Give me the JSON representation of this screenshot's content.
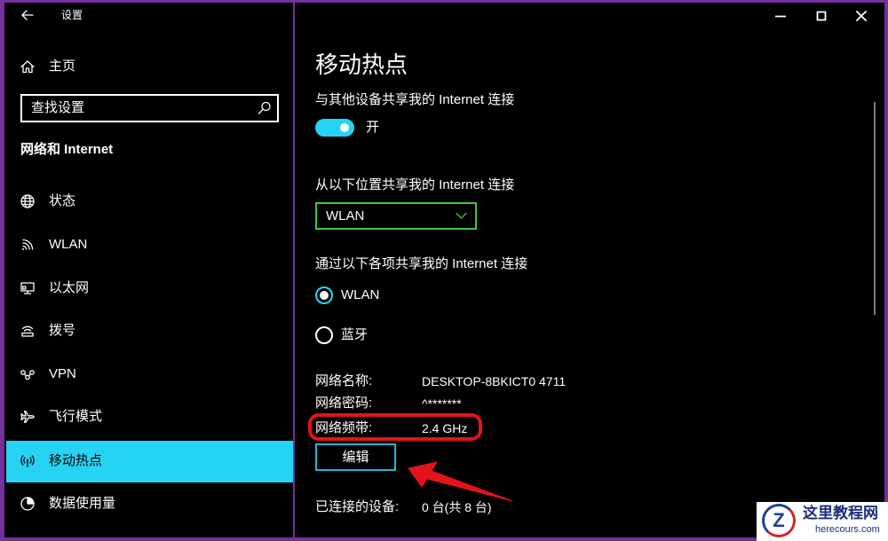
{
  "window": {
    "title": "设置",
    "icons": {
      "back": "back-arrow-icon",
      "minimize": "minimize-icon",
      "maximize": "maximize-icon",
      "close": "close-icon"
    }
  },
  "sidebar": {
    "home": {
      "label": "主页",
      "icon": "home-icon"
    },
    "search": {
      "placeholder": "查找设置",
      "icon": "search-icon"
    },
    "section_title": "网络和 Internet",
    "items": [
      {
        "label": "状态",
        "icon": "globe-icon",
        "selected": false
      },
      {
        "label": "WLAN",
        "icon": "wifi-icon",
        "selected": false
      },
      {
        "label": "以太网",
        "icon": "ethernet-icon",
        "selected": false
      },
      {
        "label": "拨号",
        "icon": "dial-up-icon",
        "selected": false
      },
      {
        "label": "VPN",
        "icon": "vpn-icon",
        "selected": false
      },
      {
        "label": "飞行模式",
        "icon": "airplane-icon",
        "selected": false
      },
      {
        "label": "移动热点",
        "icon": "mobile-hotspot-icon",
        "selected": true
      },
      {
        "label": "数据使用量",
        "icon": "data-usage-icon",
        "selected": false
      }
    ]
  },
  "main": {
    "title": "移动热点",
    "share_toggle": {
      "label": "与其他设备共享我的 Internet 连接",
      "on": true,
      "state_label": "开"
    },
    "share_from": {
      "label": "从以下位置共享我的 Internet 连接",
      "selected": "WLAN",
      "icon": "chevron-down-icon"
    },
    "share_over": {
      "label": "通过以下各项共享我的 Internet 连接",
      "options": [
        {
          "label": "WLAN",
          "checked": true
        },
        {
          "label": "蓝牙",
          "checked": false
        }
      ]
    },
    "properties": [
      {
        "label": "网络名称:",
        "value": "DESKTOP-8BKICT0 4711"
      },
      {
        "label": "网络密码:",
        "value": "^*******"
      },
      {
        "label": "网络频带:",
        "value": "2.4 GHz"
      }
    ],
    "edit_button": "编辑",
    "connected_devices": {
      "label": "已连接的设备:",
      "value": "0 台(共 8 台)"
    }
  },
  "watermark": {
    "logo_letter": "Z",
    "name": "这里教程网",
    "url": "herecours.com"
  },
  "colors": {
    "accent": "#27d3f2",
    "dropdown_border": "#3ec83b",
    "annotation_red": "#e3131c",
    "frame": "#74309c",
    "edit_button_border": "#2ab4d6",
    "background": "#000000",
    "text": "#ffffff",
    "scrollbar": "#7a7a7a"
  }
}
